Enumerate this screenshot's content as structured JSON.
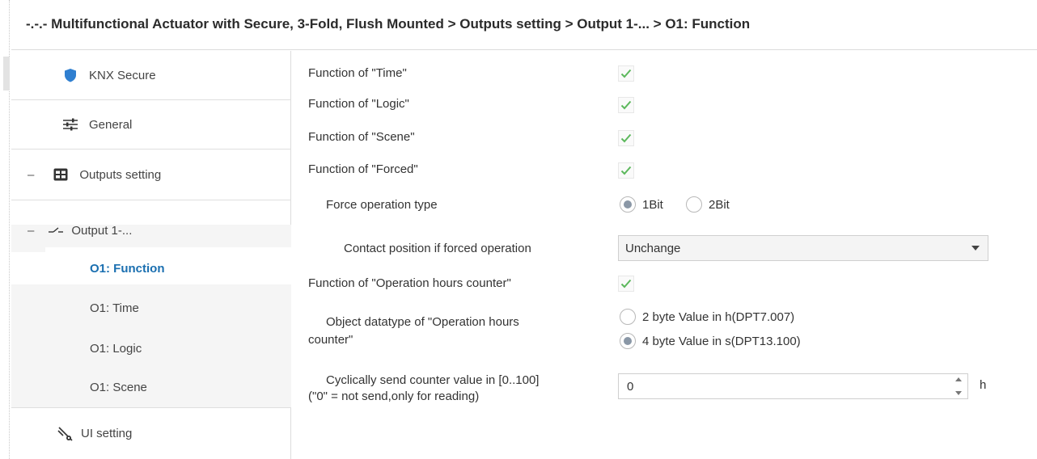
{
  "header": {
    "title": "-.-.- Multifunctional Actuator with Secure, 3-Fold, Flush Mounted > Outputs setting > Output 1-... > O1: Function"
  },
  "sidebar": {
    "items": [
      {
        "label": "KNX Secure",
        "icon": "shield-icon"
      },
      {
        "label": "General",
        "icon": "sliders-icon"
      },
      {
        "label": "Outputs setting",
        "icon": "grid-icon",
        "expander": "–"
      },
      {
        "label": "Output 1-...",
        "icon": "switch-contact-icon",
        "expander": "–"
      },
      {
        "label": "O1: Function"
      },
      {
        "label": "O1: Time"
      },
      {
        "label": "O1: Logic"
      },
      {
        "label": "O1: Scene"
      },
      {
        "label": "UI setting",
        "icon": "ui-setting-icon"
      }
    ],
    "active_color": "#1a6fb0"
  },
  "main": {
    "time_label": "Function of \"Time\"",
    "time_checked": true,
    "logic_label": "Function of \"Logic\"",
    "logic_checked": true,
    "scene_label": "Function of \"Scene\"",
    "scene_checked": true,
    "forced_label": "Function of \"Forced\"",
    "forced_checked": true,
    "force_type_label": "Force operation type",
    "force_type_options": [
      "1Bit",
      "2Bit"
    ],
    "force_type_selected": "1Bit",
    "contact_label": "Contact position if forced operation",
    "contact_value": "Unchange",
    "ohc_label": "Function of \"Operation hours counter\"",
    "ohc_checked": true,
    "datatype_label_1": "Object datatype of \"Operation hours",
    "datatype_label_2": "counter\"",
    "datatype_options": [
      "2 byte Value in h(DPT7.007)",
      "4 byte Value in s(DPT13.100)"
    ],
    "datatype_selected": "4 byte Value in s(DPT13.100)",
    "cyclic_label_1": "Cyclically send counter value in [0..100]",
    "cyclic_label_2": "(\"0\" = not send,only for reading)",
    "cyclic_value": "0",
    "cyclic_unit": "h",
    "check_color": "#5cb85c"
  }
}
